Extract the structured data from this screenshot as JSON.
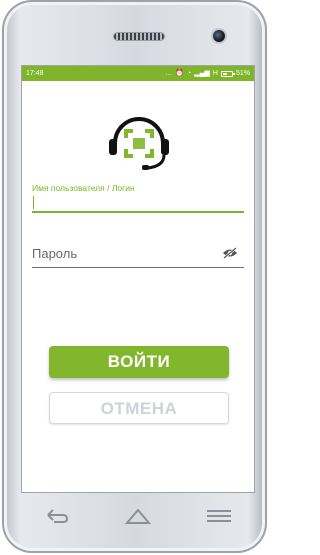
{
  "status_bar": {
    "time": "17:48",
    "network_label": "H",
    "battery_percent": "51%",
    "battery_level": 0.51,
    "background_color": "#7fb52a"
  },
  "logo": {
    "icon": "headset-support-icon",
    "accent_color": "#82b72d"
  },
  "login_form": {
    "username_label": "Имя пользователя / Логин",
    "username_value": "",
    "password_placeholder": "Пароль",
    "password_visibility_icon": "eye-off-icon"
  },
  "buttons": {
    "login_label": "ВОЙТИ",
    "cancel_label": "ОТМЕНА"
  },
  "navigation": {
    "back_icon": "back-arrow-icon",
    "home_icon": "home-icon",
    "menu_icon": "menu-icon"
  }
}
